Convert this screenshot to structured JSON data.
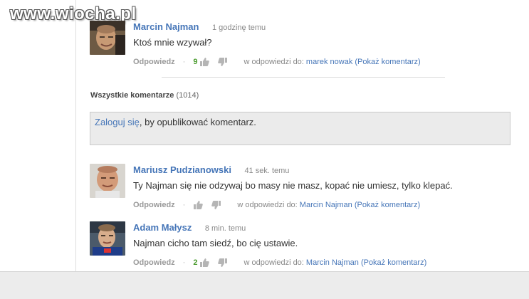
{
  "watermark": "www.wiocha.pl",
  "comments": [
    {
      "author": "Marcin Najman",
      "time": "1 godzinę temu",
      "text": "Ktoś mnie wzywał?",
      "reply_label": "Odpowiedz",
      "likes": "9",
      "in_reply_prefix": "w odpowiedzi do:",
      "in_reply_link": "marek nowak (Pokaż komentarz)"
    },
    {
      "author": "Mariusz Pudzianowski",
      "time": "41 sek. temu",
      "text": "Ty Najman się nie odzywaj bo masy nie masz, kopać nie umiesz, tylko klepać.",
      "reply_label": "Odpowiedz",
      "likes": "",
      "in_reply_prefix": "w odpowiedzi do:",
      "in_reply_link": "Marcin Najman (Pokaż komentarz)"
    },
    {
      "author": "Adam Małysz",
      "time": "8 min. temu",
      "text": "Najman cicho tam siedź, bo cię ustawie.",
      "reply_label": "Odpowiedz",
      "likes": "2",
      "in_reply_prefix": "w odpowiedzi do:",
      "in_reply_link": "Marcin Najman (Pokaż komentarz)"
    }
  ],
  "section": {
    "title": "Wszystkie komentarze",
    "count": "(1014)"
  },
  "login": {
    "link": "Zaloguj się",
    "rest": ", by opublikować komentarz."
  },
  "dot": "·"
}
